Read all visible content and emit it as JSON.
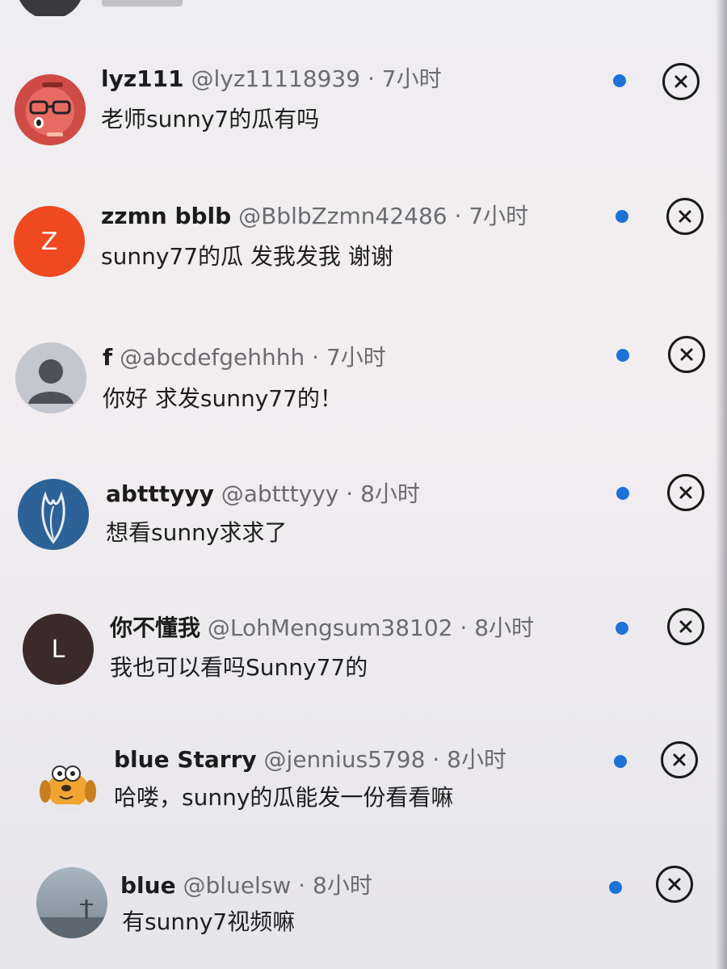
{
  "colors": {
    "unread_dot": "#1d72d8",
    "avatar_zzmn": "#ef4a1f",
    "avatar_l": "#3b2a2a"
  },
  "notifications": [
    {
      "name": "lyz111",
      "handle": "@lyz11118939",
      "separator": "·",
      "time": "7小时",
      "text": "老师sunny7的瓜有吗",
      "avatar_icon": "red-cartoon-face-avatar"
    },
    {
      "name": "zzmn bblb",
      "handle": "@BblbZzmn42486",
      "separator": "·",
      "time": "7小时",
      "text": "sunny77的瓜 发我发我 谢谢",
      "avatar_letter": "Z"
    },
    {
      "name": "f",
      "handle": "@abcdefgehhhh",
      "separator": "·",
      "time": "7小时",
      "text": "你好 求发sunny77的！",
      "avatar_icon": "default-person-avatar"
    },
    {
      "name": "abtttyyy",
      "handle": "@abtttyyy",
      "separator": "·",
      "time": "8小时",
      "text": "想看sunny求求了",
      "avatar_icon": "blue-leaf-avatar"
    },
    {
      "name": "你不懂我",
      "handle": "@LohMengsum38102",
      "separator": "·",
      "time": "8小时",
      "text": "我也可以看吗Sunny77的",
      "avatar_letter": "L"
    },
    {
      "name": "blue Starry",
      "handle": "@jennius5798",
      "separator": "·",
      "time": "8小时",
      "text": "哈喽，sunny的瓜能发一份看看嘛",
      "avatar_icon": "cartoon-dog-avatar"
    },
    {
      "name": "blue",
      "handle": "@bluelsw",
      "separator": "·",
      "time": "8小时",
      "text": "有sunny7视频嘛",
      "avatar_icon": "sky-photo-avatar"
    }
  ]
}
